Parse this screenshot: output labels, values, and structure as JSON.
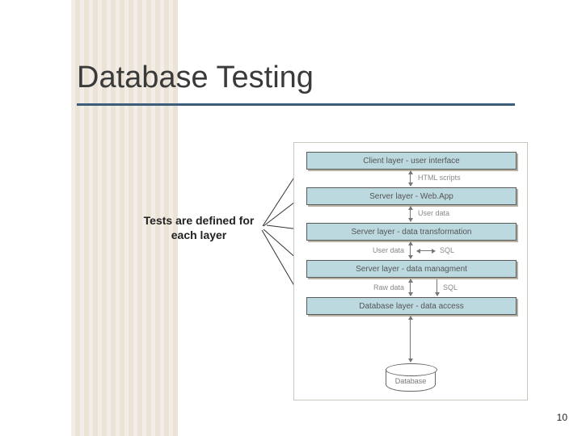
{
  "title": "Database Testing",
  "annotation": {
    "line1": "Tests are defined for",
    "line2": "each layer"
  },
  "page_number": "10",
  "diagram": {
    "layers": [
      "Client layer - user interface",
      "Server layer - Web.App",
      "Server layer - data transformation",
      "Server layer - data managment",
      "Database layer - data access"
    ],
    "flows": {
      "f0": "HTML scripts",
      "f1": "User data",
      "f2_left": "User data",
      "f2_right": "SQL",
      "f3_left": "Raw data",
      "f3_right": "SQL"
    },
    "database": "Database"
  }
}
